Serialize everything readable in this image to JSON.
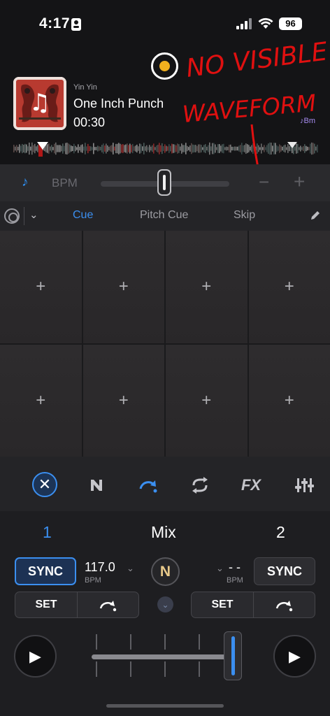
{
  "status_bar": {
    "time": "4:17",
    "battery": "96"
  },
  "track": {
    "artist": "Yin Yin",
    "title": "One Inch Punch",
    "elapsed": "00:30",
    "key": "♪Bm"
  },
  "annotation": {
    "line1": "NO VISIBLE",
    "line2": "WAVEFORM",
    "color": "#e01010"
  },
  "tempo": {
    "note_icon": "♪",
    "bpm_label": "BPM",
    "minus": "−",
    "plus": "+"
  },
  "pad_mode": {
    "dropdown_chevron": "⌄",
    "tabs": [
      "Cue",
      "Pitch Cue",
      "Skip"
    ],
    "active_tab": "Cue"
  },
  "pads": [
    "+",
    "+",
    "+",
    "+",
    "+",
    "+",
    "+",
    "+"
  ],
  "toolbar": {
    "close_glyph": "✕",
    "fx_label": "FX"
  },
  "decks": {
    "left_number": "1",
    "mix_label": "Mix",
    "right_number": "2",
    "sync_label": "SYNC",
    "left_bpm": "117.0",
    "right_bpm": "- -",
    "bpm_unit": "BPM",
    "n_logo": "N",
    "set_label": "SET",
    "chevron": "⌄",
    "play_glyph": "▶"
  },
  "colors": {
    "accent": "#3b8ff0",
    "record_dot": "#f2b01e",
    "key_color": "#a68cf0"
  }
}
